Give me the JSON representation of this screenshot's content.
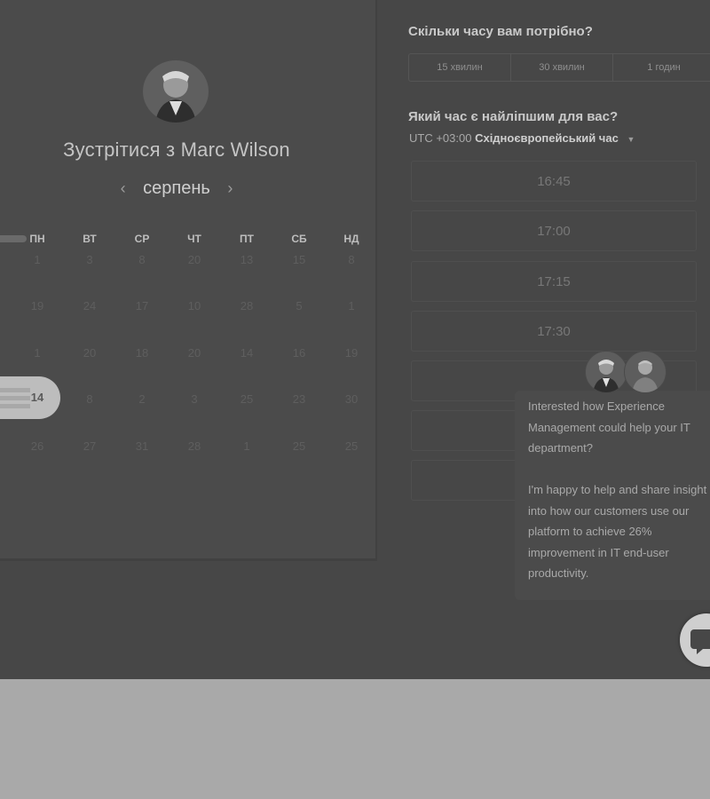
{
  "left_panel": {
    "title_prefix": "Зустрітися з",
    "host_name": "Marc Wilson",
    "month": "серпень",
    "prev_arrow": "‹",
    "next_arrow": "›",
    "weekdays": [
      "ПН",
      "ВТ",
      "СР",
      "ЧТ",
      "ПТ",
      "СБ",
      "НД"
    ],
    "weeks": [
      [
        "1",
        "3",
        "8",
        "20",
        "13",
        "15",
        "8"
      ],
      [
        "19",
        "24",
        "17",
        "10",
        "28",
        "5",
        "1"
      ],
      [
        "1",
        "20",
        "18",
        "20",
        "14",
        "16",
        "19"
      ],
      [
        "14",
        "8",
        "2",
        "3",
        "25",
        "23",
        "30"
      ],
      [
        "26",
        "27",
        "31",
        "28",
        "1",
        "25",
        "25"
      ]
    ],
    "selected_day": "14"
  },
  "right_panel": {
    "duration_question": "Скільки часу вам потрібно?",
    "durations": [
      "15 хвилин",
      "30 хвилин",
      "1 годин"
    ],
    "time_question": "Який час є найліпшим для вас?",
    "timezone_prefix": "UTC +03:00",
    "timezone_name": "Східноєвропейський час",
    "slots": [
      "16:45",
      "17:00",
      "17:15",
      "17:30"
    ]
  },
  "chat": {
    "message_1": "Interested how Experience Management could help your IT department?",
    "message_2": "I'm happy to help and share insight into how our customers use our platform to achieve 26% improvement in IT end-user productivity."
  },
  "colors": {
    "overlay": "#474747",
    "page_bg": "#a9a9a9",
    "selected_day_bg": "#bdbdbd"
  }
}
